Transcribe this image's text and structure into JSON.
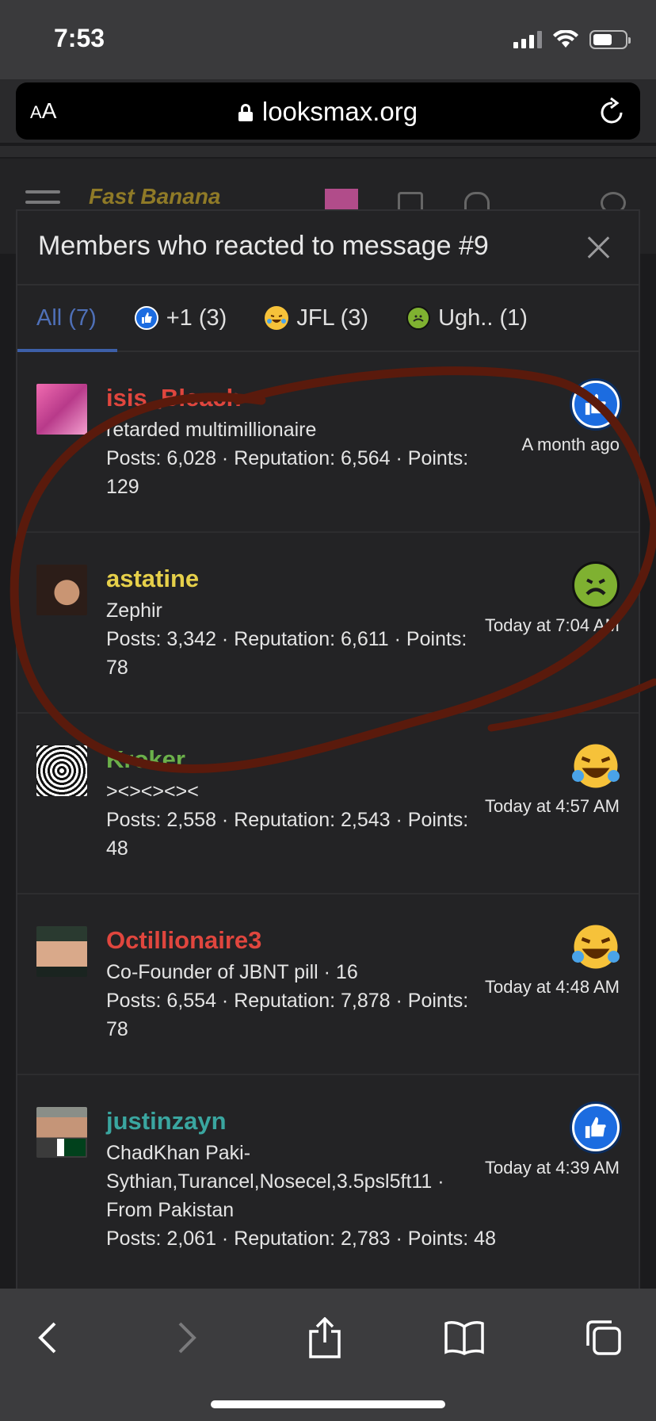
{
  "status_bar": {
    "time": "7:53"
  },
  "browser": {
    "aa_label": "A",
    "aa_label_large": "A",
    "url": "looksmax.org"
  },
  "site": {
    "logo_text": "Fast Banana"
  },
  "modal": {
    "title": "Members who reacted to message #9",
    "tabs": [
      {
        "label": "All (7)",
        "emoji": ""
      },
      {
        "label": "+1 (3)",
        "emoji": "like-icon"
      },
      {
        "label": "JFL (3)",
        "emoji": "jfl-icon"
      },
      {
        "label": "Ugh.. (1)",
        "emoji": "ugh-icon"
      }
    ],
    "members": [
      {
        "name": "isis_Bleach",
        "name_color": "#e0463e",
        "title": "retarded multimillionaire",
        "stats": "Posts: 6,028 · Reputation: 6,564 · Points: 129",
        "reaction": "like",
        "time": "A month ago"
      },
      {
        "name": "astatine",
        "name_color": "#e6d04a",
        "title": "Zephir",
        "stats": "Posts: 3,342 · Reputation: 6,611 · Points: 78",
        "reaction": "ugh",
        "time": "Today at 7:04 AM"
      },
      {
        "name": "Kroker",
        "name_color": "#6bb04a",
        "title": "><><><><",
        "stats": "Posts: 2,558 · Reputation: 2,543 · Points: 48",
        "reaction": "jfl",
        "time": "Today at 4:57 AM"
      },
      {
        "name": "Octillionaire3",
        "name_color": "#e0463e",
        "title": "Co-Founder of JBNT pill · 16",
        "stats": "Posts: 6,554 · Reputation: 7,878 · Points: 78",
        "reaction": "jfl",
        "time": "Today at 4:48 AM"
      },
      {
        "name": "justinzayn",
        "name_color": "#3aa6a0",
        "title": "ChadKhan Paki-Sythian,Turancel,Nosecel,3.5psl5ft11 · From Pakistan",
        "stats": "Posts: 2,061 · Reputation: 2,783 · Points: 48",
        "reaction": "like",
        "time": "Today at 4:39 AM"
      }
    ]
  },
  "colors": {
    "accent": "#3d5fa8",
    "annotation_red": "#6b1f10"
  }
}
